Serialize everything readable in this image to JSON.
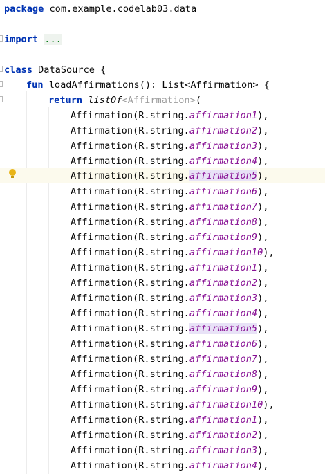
{
  "header": {
    "package_kw": "package",
    "package_name": " com.example.codelab03.data",
    "import_kw": "import",
    "import_dots": "...",
    "class_kw": "class",
    "class_name": " DataSource {",
    "fun_kw": "fun",
    "fun_sig": " loadAffirmations(): List<Affirmation> {",
    "return_kw": "return",
    "listof": "listOf",
    "generic": "<Affirmation>",
    "open_paren": "("
  },
  "items": [
    {
      "prefix": "Affirmation(R.string.",
      "name": "affirmation1",
      "suffix": "),"
    },
    {
      "prefix": "Affirmation(R.string.",
      "name": "affirmation2",
      "suffix": "),"
    },
    {
      "prefix": "Affirmation(R.string.",
      "name": "affirmation3",
      "suffix": "),"
    },
    {
      "prefix": "Affirmation(R.string.",
      "name": "affirmation4",
      "suffix": "),"
    },
    {
      "prefix": "Affirmation(R.string.",
      "name": "affirmation5",
      "suffix": "),"
    },
    {
      "prefix": "Affirmation(R.string.",
      "name": "affirmation6",
      "suffix": "),"
    },
    {
      "prefix": "Affirmation(R.string.",
      "name": "affirmation7",
      "suffix": "),"
    },
    {
      "prefix": "Affirmation(R.string.",
      "name": "affirmation8",
      "suffix": "),"
    },
    {
      "prefix": "Affirmation(R.string.",
      "name": "affirmation9",
      "suffix": "),"
    },
    {
      "prefix": "Affirmation(R.string.",
      "name": "affirmation10",
      "suffix": "),"
    },
    {
      "prefix": "Affirmation(R.string.",
      "name": "affirmation1",
      "suffix": "),"
    },
    {
      "prefix": "Affirmation(R.string.",
      "name": "affirmation2",
      "suffix": "),"
    },
    {
      "prefix": "Affirmation(R.string.",
      "name": "affirmation3",
      "suffix": "),"
    },
    {
      "prefix": "Affirmation(R.string.",
      "name": "affirmation4",
      "suffix": "),"
    },
    {
      "prefix": "Affirmation(R.string.",
      "name": "affirmation5",
      "suffix": "),"
    },
    {
      "prefix": "Affirmation(R.string.",
      "name": "affirmation6",
      "suffix": "),"
    },
    {
      "prefix": "Affirmation(R.string.",
      "name": "affirmation7",
      "suffix": "),"
    },
    {
      "prefix": "Affirmation(R.string.",
      "name": "affirmation8",
      "suffix": "),"
    },
    {
      "prefix": "Affirmation(R.string.",
      "name": "affirmation9",
      "suffix": "),"
    },
    {
      "prefix": "Affirmation(R.string.",
      "name": "affirmation10",
      "suffix": "),"
    },
    {
      "prefix": "Affirmation(R.string.",
      "name": "affirmation1",
      "suffix": "),"
    },
    {
      "prefix": "Affirmation(R.string.",
      "name": "affirmation2",
      "suffix": "),"
    },
    {
      "prefix": "Affirmation(R.string.",
      "name": "affirmation3",
      "suffix": "),"
    },
    {
      "prefix": "Affirmation(R.string.",
      "name": "affirmation4",
      "suffix": "),"
    }
  ],
  "colors": {
    "keyword": "#0033b3",
    "property": "#871094",
    "generic": "#9e9e9e",
    "current_line": "#fcfaed",
    "usage_highlight": "#e8e2f7",
    "bulb": "#e8b418"
  },
  "icons": {
    "gutter_intention": "lightbulb-icon",
    "fold": "fold-marker-icon"
  }
}
